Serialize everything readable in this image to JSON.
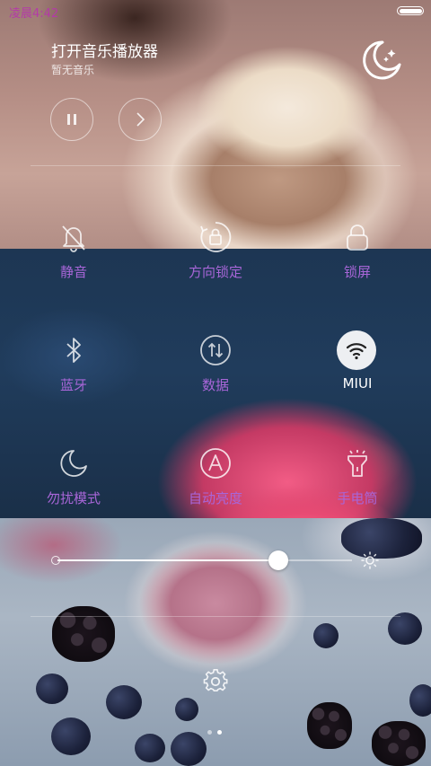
{
  "status_bar": {
    "time": "凌晨4:42",
    "battery_level": 1.0
  },
  "music": {
    "title": "打开音乐播放器",
    "subtitle": "暂无音乐"
  },
  "toggles": [
    {
      "label": "静音",
      "icon": "bell-off-icon",
      "active": false
    },
    {
      "label": "方向锁定",
      "icon": "rotation-lock-icon",
      "active": false
    },
    {
      "label": "锁屏",
      "icon": "lock-icon",
      "active": false
    },
    {
      "label": "蓝牙",
      "icon": "bluetooth-icon",
      "active": false
    },
    {
      "label": "数据",
      "icon": "mobile-data-icon",
      "active": false
    },
    {
      "label": "MIUI",
      "icon": "wifi-icon",
      "active": true
    },
    {
      "label": "勿扰模式",
      "icon": "moon-icon",
      "active": false
    },
    {
      "label": "自动亮度",
      "icon": "auto-brightness-icon",
      "active": false
    },
    {
      "label": "手电筒",
      "icon": "flashlight-icon",
      "active": false
    }
  ],
  "brightness": {
    "level": 0.75
  },
  "pager": {
    "page_count": 2,
    "current_page": 2
  },
  "colors": {
    "status_time": "#b43aa8",
    "toggle_label": "#a866d8",
    "active_toggle_bg": "#ffffff"
  }
}
